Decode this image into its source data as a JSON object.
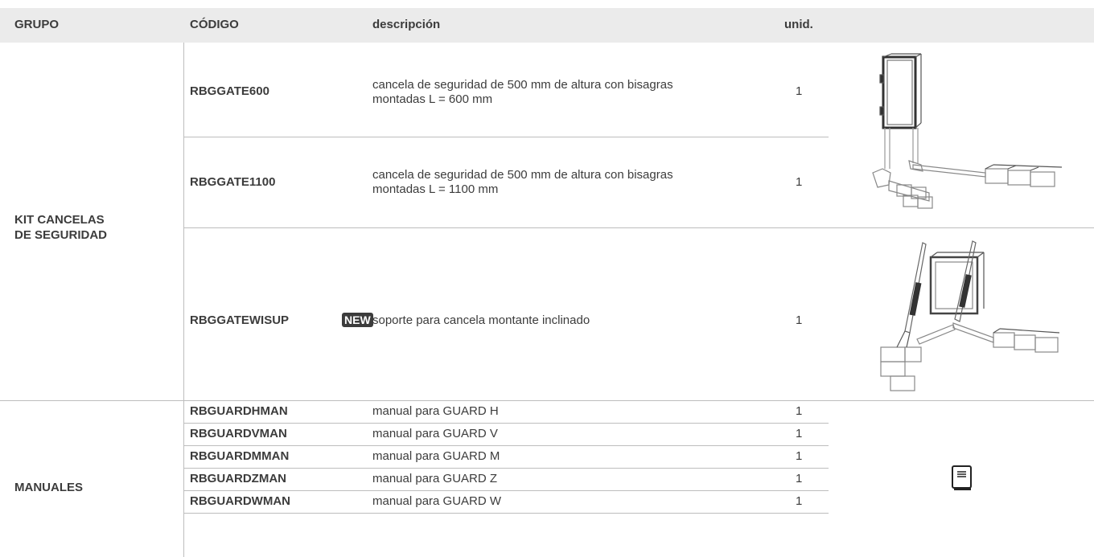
{
  "header": {
    "grupo": "GRUPO",
    "codigo": "CÓDIGO",
    "descripcion": "descripción",
    "unid": "unid."
  },
  "groups": {
    "kit": [
      "KIT CANCELAS",
      "DE SEGURIDAD"
    ],
    "manuales": "MANUALES"
  },
  "kit_rows": [
    {
      "code": "RBGGATE600",
      "desc": [
        "cancela de seguridad de 500 mm de altura con bisagras",
        "montadas L = 600 mm"
      ],
      "unit": "1"
    },
    {
      "code": "RBGGATE1100",
      "desc": [
        "cancela de seguridad de 500 mm de altura con bisagras",
        "montadas L = 1100 mm"
      ],
      "unit": "1"
    },
    {
      "code": "RBGGATEWISUP",
      "badge": "NEW",
      "desc": [
        "soporte para cancela montante inclinado"
      ],
      "unit": "1"
    }
  ],
  "manual_rows": [
    {
      "code": "RBGUARDHMAN",
      "desc": "manual para GUARD H",
      "unit": "1"
    },
    {
      "code": "RBGUARDVMAN",
      "desc": "manual para GUARD V",
      "unit": "1"
    },
    {
      "code": "RBGUARDMMAN",
      "desc": "manual para GUARD M",
      "unit": "1"
    },
    {
      "code": "RBGUARDZMAN",
      "desc": "manual para GUARD Z",
      "unit": "1"
    },
    {
      "code": "RBGUARDWMAN",
      "desc": "manual para GUARD W",
      "unit": "1"
    }
  ],
  "icons": {
    "gate_straight": "gate-straight-illustration",
    "gate_inclined": "gate-inclined-illustration",
    "manual": "manual-book-icon"
  }
}
